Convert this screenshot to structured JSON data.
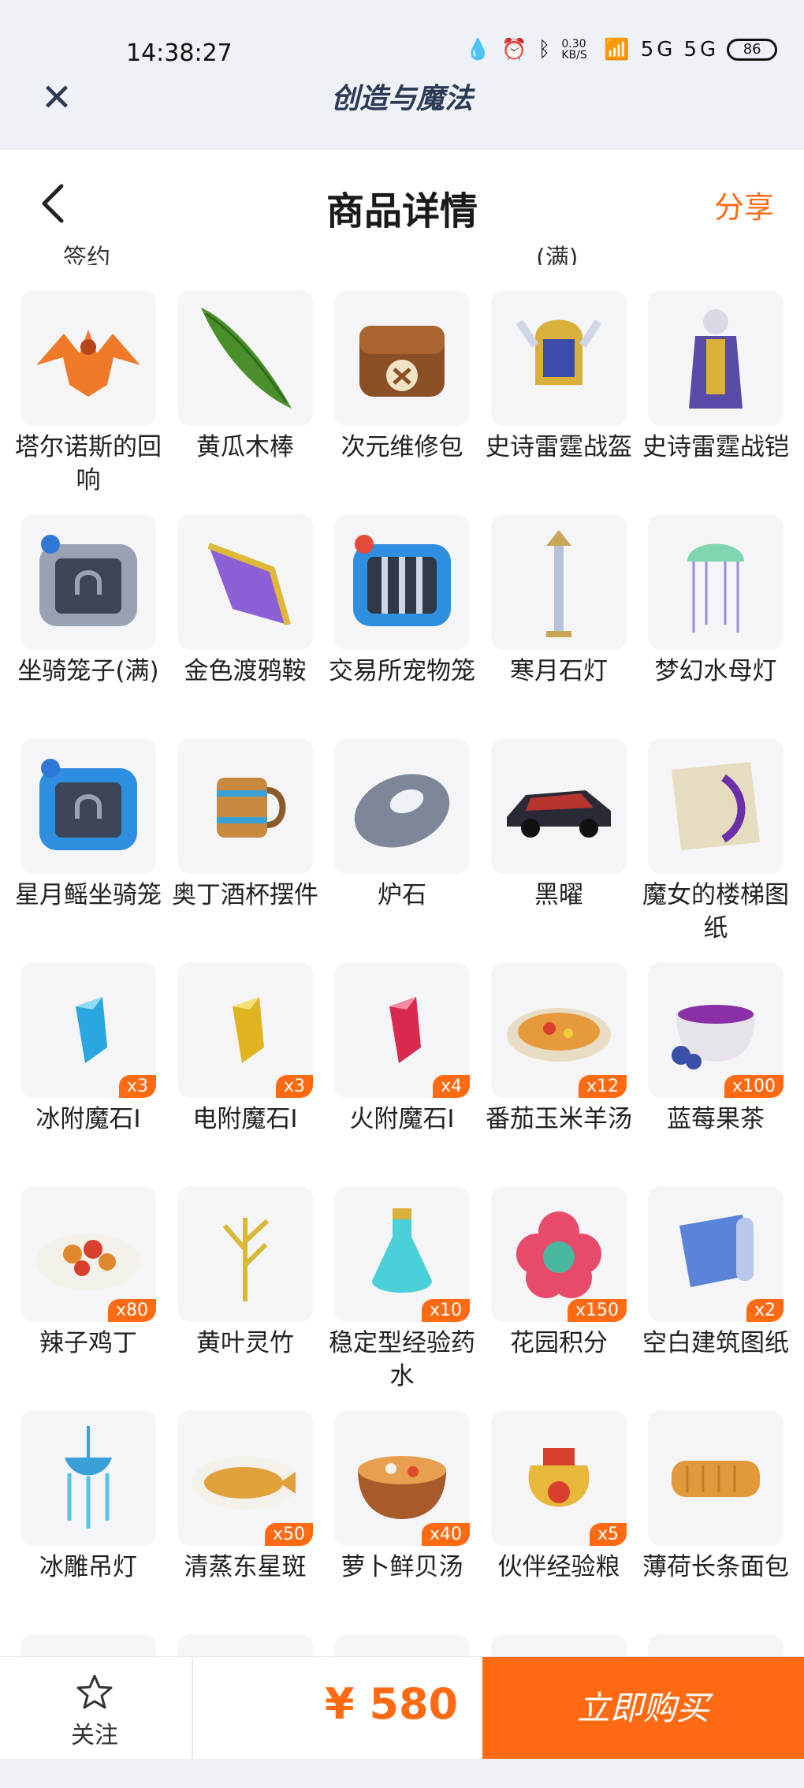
{
  "status_bar": {
    "time": "14:38:27",
    "icons": [
      "drop-icon",
      "alarm-icon",
      "bluetooth-icon",
      "data-speed",
      "wifi-icon",
      "signal-5g-icon",
      "signal-5g-icon",
      "battery-icon"
    ],
    "net_speed": "0.30 KB/S",
    "battery": "86"
  },
  "app_header": {
    "title": "创造与魔法"
  },
  "nav": {
    "title": "商品详情",
    "share": "分享"
  },
  "cutoff_row": [
    "签约",
    "(满)"
  ],
  "items": [
    {
      "name": "塔尔诺斯的回响",
      "icon": "dragon-icon",
      "qty": ""
    },
    {
      "name": "黄瓜木棒",
      "icon": "cucumber-stick-icon",
      "qty": ""
    },
    {
      "name": "次元维修包",
      "icon": "repair-bag-icon",
      "qty": ""
    },
    {
      "name": "史诗雷霆战盔",
      "icon": "helmet-icon",
      "qty": ""
    },
    {
      "name": "史诗雷霆战铠",
      "icon": "armor-icon",
      "qty": ""
    },
    {
      "name": "坐骑笼子(满)",
      "icon": "mount-cage-icon",
      "qty": ""
    },
    {
      "name": "金色渡鸦鞍",
      "icon": "saddle-icon",
      "qty": ""
    },
    {
      "name": "交易所宠物笼",
      "icon": "pet-cage-icon",
      "qty": ""
    },
    {
      "name": "寒月石灯",
      "icon": "stone-lamp-icon",
      "qty": ""
    },
    {
      "name": "梦幻水母灯",
      "icon": "jellyfish-lamp-icon",
      "qty": ""
    },
    {
      "name": "星月鳐坐骑笼",
      "icon": "mount-cage-icon",
      "qty": ""
    },
    {
      "name": "奥丁酒杯摆件",
      "icon": "beer-mug-icon",
      "qty": ""
    },
    {
      "name": "炉石",
      "icon": "hearthstone-icon",
      "qty": ""
    },
    {
      "name": "黑曜",
      "icon": "car-icon",
      "qty": ""
    },
    {
      "name": "魔女的楼梯图纸",
      "icon": "blueprint-icon",
      "qty": ""
    },
    {
      "name": "冰附魔石Ⅰ",
      "icon": "ice-crystal-icon",
      "qty": "x3"
    },
    {
      "name": "电附魔石Ⅰ",
      "icon": "thunder-crystal-icon",
      "qty": "x3"
    },
    {
      "name": "火附魔石Ⅰ",
      "icon": "fire-crystal-icon",
      "qty": "x4"
    },
    {
      "name": "番茄玉米羊汤",
      "icon": "soup-bowl-icon",
      "qty": "x12"
    },
    {
      "name": "蓝莓果茶",
      "icon": "tea-cup-icon",
      "qty": "x100"
    },
    {
      "name": "辣子鸡丁",
      "icon": "spicy-chicken-icon",
      "qty": "x80"
    },
    {
      "name": "黄叶灵竹",
      "icon": "bamboo-icon",
      "qty": ""
    },
    {
      "name": "稳定型经验药水",
      "icon": "potion-icon",
      "qty": "x10"
    },
    {
      "name": "花园积分",
      "icon": "flower-token-icon",
      "qty": "x150"
    },
    {
      "name": "空白建筑图纸",
      "icon": "scroll-icon",
      "qty": "x2"
    },
    {
      "name": "冰雕吊灯",
      "icon": "chandelier-icon",
      "qty": ""
    },
    {
      "name": "清蒸东星斑",
      "icon": "steamed-fish-icon",
      "qty": "x50"
    },
    {
      "name": "萝卜鲜贝汤",
      "icon": "soup-bowl-icon",
      "qty": "x40"
    },
    {
      "name": "伙伴经验粮",
      "icon": "food-bag-icon",
      "qty": "x5"
    },
    {
      "name": "薄荷长条面包",
      "icon": "bread-icon",
      "qty": ""
    }
  ],
  "bottom_bar": {
    "follow": "关注",
    "price": "¥ 580",
    "buy": "立即购买"
  },
  "colors": {
    "accent": "#ff6a13",
    "header_bg": "#eef2f6",
    "title_color": "#2d3a55"
  }
}
